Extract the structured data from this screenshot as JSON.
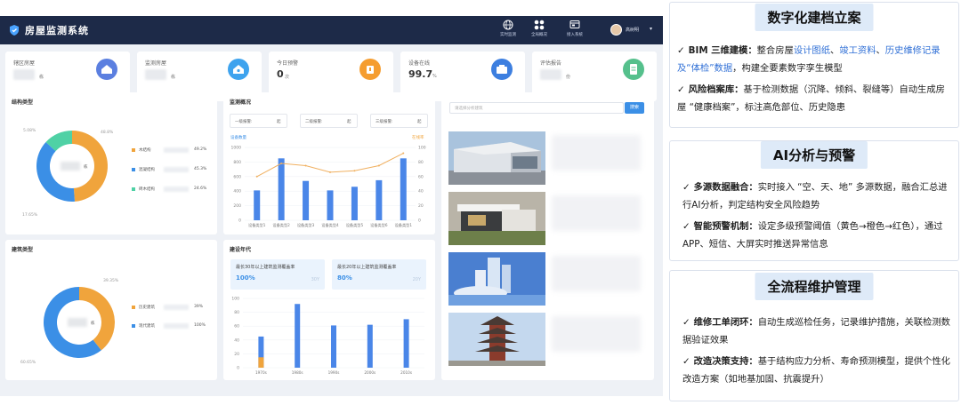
{
  "app": {
    "title": "房屋监测系统",
    "nav": [
      {
        "label": "实时监测",
        "icon": "globe-icon"
      },
      {
        "label": "全局概况",
        "icon": "grid-icon"
      },
      {
        "label": "接入系统",
        "icon": "monitor-icon"
      }
    ],
    "user": {
      "name": "高树明",
      "caret": "▾"
    }
  },
  "stats": [
    {
      "label": "辖区房屋",
      "unit": "栋",
      "value": "",
      "color": "#5b7fe0"
    },
    {
      "label": "监测房屋",
      "unit": "栋",
      "value": "",
      "color": "#3ea3ee"
    },
    {
      "label": "今日预警",
      "unit": "次",
      "value": "0",
      "color": "#f59d30"
    },
    {
      "label": "设备在线",
      "unit": "%",
      "value": "99.7",
      "color": "#3d7fe0"
    },
    {
      "label": "评估报告",
      "unit": "份",
      "value": "",
      "color": "#55c08c"
    }
  ],
  "structure_panel": {
    "title": "结构类型",
    "center_unit": "栋",
    "labels": [
      "5.08%",
      "48.8%",
      "17.65%"
    ],
    "legend": [
      {
        "name": "木结构",
        "pct": "49.2%",
        "color": "#f0a43c"
      },
      {
        "name": "混凝结构",
        "pct": "45.3%",
        "color": "#3b8fe6"
      },
      {
        "name": "砖木结构",
        "pct": "24.6%",
        "color": "#4fd1a5"
      }
    ]
  },
  "building_panel": {
    "title": "建筑类型",
    "center_unit": "栋",
    "labels": [
      "39.35%",
      "60.65%"
    ],
    "legend": [
      {
        "name": "历史建筑",
        "pct": "39%",
        "color": "#f0a43c"
      },
      {
        "name": "现代建筑",
        "pct": "100%",
        "color": "#3b8fe6"
      }
    ]
  },
  "monitor_panel": {
    "title": "监测概况",
    "alerts": [
      {
        "label": "一级报警:",
        "value": "起"
      },
      {
        "label": "二级报警:",
        "value": "起"
      },
      {
        "label": "三级报警:",
        "value": "起"
      }
    ],
    "left_axis_label": "设备数量",
    "right_axis_label": "在线率"
  },
  "year_panel": {
    "title": "建设年代",
    "cards": [
      {
        "title": "最长30年以上建筑监测覆盖率",
        "value": "100%",
        "watermark": "30Y"
      },
      {
        "title": "最长20年以上建筑监测覆盖率",
        "value": "80%",
        "watermark": "20Y"
      }
    ]
  },
  "list_panel": {
    "search_placeholder": "请选择分析建筑",
    "search_button": "搜索"
  },
  "chart_data": [
    {
      "type": "pie",
      "title": "结构类型",
      "slices": [
        {
          "label": "",
          "value": 48.8,
          "color": "#f0a43c"
        },
        {
          "label": "",
          "value": 38.0,
          "color": "#3b8fe6"
        },
        {
          "label": "",
          "value": 13.2,
          "color": "#4fd1a5"
        }
      ]
    },
    {
      "type": "bar",
      "title": "监测概况",
      "categories": [
        "设备类型1",
        "设备类型2",
        "设备类型3",
        "设备类型4",
        "设备类型5",
        "设备类型6",
        "设备类型1"
      ],
      "series": [
        {
          "values": [
            410,
            850,
            540,
            410,
            460,
            550,
            850
          ],
          "color": "#4a86e8"
        },
        {
          "values": [
            60,
            78,
            75,
            66,
            68,
            75,
            92
          ],
          "color": "#f0b060",
          "kind": "line"
        }
      ],
      "ylim": [
        0,
        1000
      ],
      "yticks": [
        0,
        200,
        400,
        600,
        800,
        1000
      ],
      "y2lim": [
        0,
        100
      ],
      "y2ticks": [
        0,
        20,
        40,
        60,
        80,
        100
      ]
    },
    {
      "type": "pie",
      "title": "建筑类型",
      "slices": [
        {
          "label": "",
          "value": 39.35,
          "color": "#f0a43c"
        },
        {
          "label": "",
          "value": 60.65,
          "color": "#3b8fe6"
        }
      ]
    },
    {
      "type": "bar",
      "title": "建设年代",
      "categories": [
        "1970s",
        "1980s",
        "1990s",
        "2000s",
        "2010s"
      ],
      "series": [
        {
          "values": [
            45,
            92,
            61,
            62,
            70
          ],
          "color": "#4a86e8"
        },
        {
          "values": [
            15,
            0,
            0,
            0,
            0
          ],
          "color": "#f0a43c"
        }
      ],
      "ylim": [
        0,
        100
      ],
      "yticks": [
        0,
        20,
        40,
        60,
        80,
        100
      ]
    }
  ],
  "features": [
    {
      "heading": "数字化建档立案",
      "items": [
        [
          {
            "t": "BIM 三维建模：",
            "s": "b"
          },
          {
            "t": "整合房屋",
            "s": ""
          },
          {
            "t": "设计图纸",
            "s": "hl"
          },
          {
            "t": "、",
            "s": ""
          },
          {
            "t": "竣工资料",
            "s": "hl"
          },
          {
            "t": "、",
            "s": ""
          },
          {
            "t": "历史维修记录及“体检”数据",
            "s": "hl"
          },
          {
            "t": "，构建全要素数字孪生模型",
            "s": ""
          }
        ],
        [
          {
            "t": "风险档案库：",
            "s": "b"
          },
          {
            "t": "基于检测数据（沉降、倾斜、裂缝等）自动生成房屋 “健康档案”，标注高危部位、历史隐患",
            "s": ""
          }
        ]
      ]
    },
    {
      "heading": "AI分析与预警",
      "items": [
        [
          {
            "t": "多源数据融合：",
            "s": "b"
          },
          {
            "t": "实时接入 “空、天、地” 多源数据，融合汇总进行AI分析，判定结构安全风险趋势",
            "s": ""
          }
        ],
        [
          {
            "t": "智能预警机制：",
            "s": "b"
          },
          {
            "t": "设定多级预警阈值（黄色→橙色→红色），通过 APP、短信、大屏实时推送异常信息",
            "s": ""
          }
        ]
      ]
    },
    {
      "heading": "全流程维护管理",
      "items": [
        [
          {
            "t": "维修工单闭环：",
            "s": "b"
          },
          {
            "t": "自动生成巡检任务，记录维护措施，关联检测数据验证效果",
            "s": ""
          }
        ],
        [
          {
            "t": "改造决策支持：",
            "s": "b"
          },
          {
            "t": "基于结构应力分析、寿命预测模型，提供个性化改造方案（如地基加固、抗震提升）",
            "s": ""
          }
        ]
      ]
    }
  ]
}
